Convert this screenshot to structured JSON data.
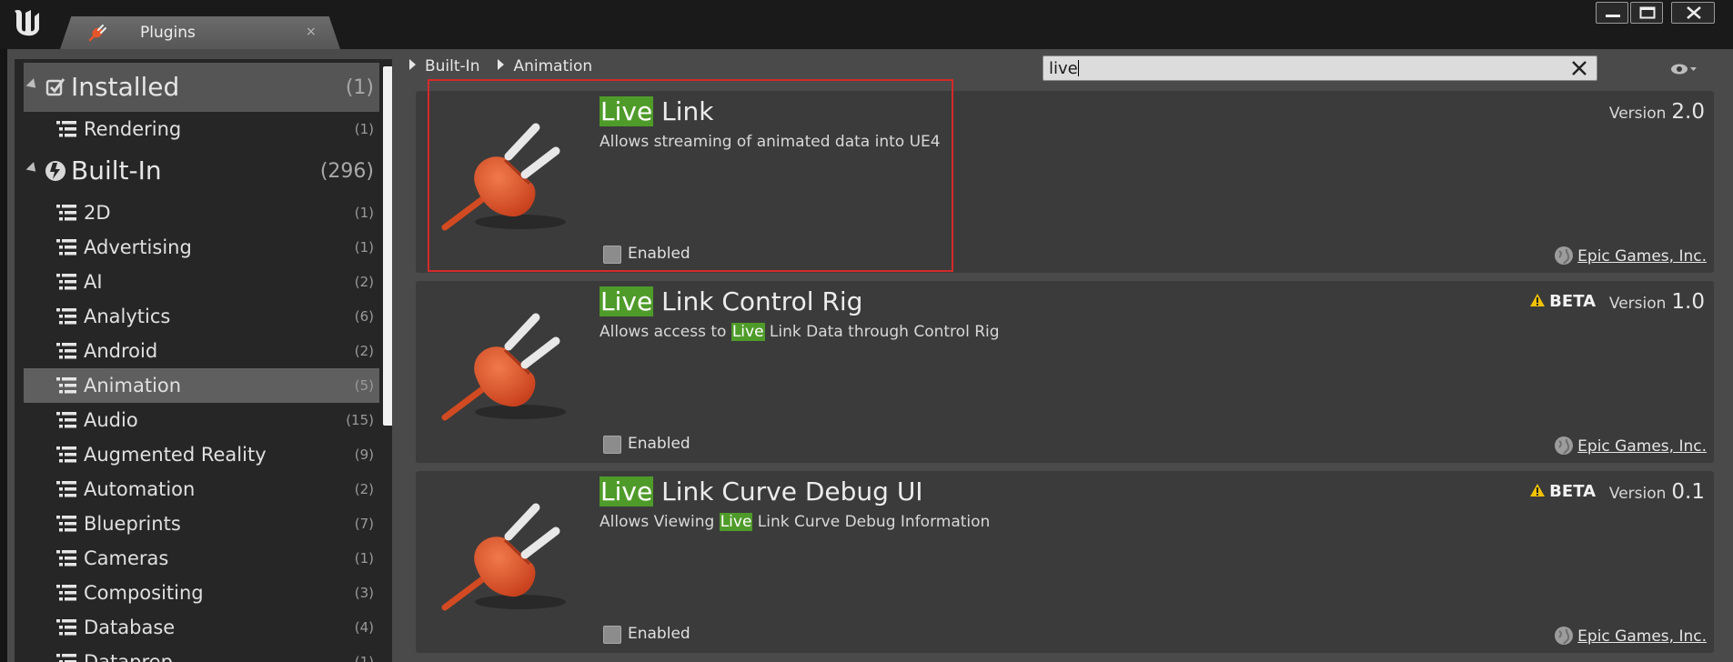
{
  "window": {
    "tab_title": "Plugins",
    "tab_close": "×"
  },
  "sidebar": {
    "categories": [
      {
        "label": "Installed",
        "count": "(1)",
        "items": [
          {
            "label": "Rendering",
            "count": "(1)"
          }
        ]
      },
      {
        "label": "Built-In",
        "count": "(296)",
        "items": [
          {
            "label": "2D",
            "count": "(1)"
          },
          {
            "label": "Advertising",
            "count": "(1)"
          },
          {
            "label": "AI",
            "count": "(2)"
          },
          {
            "label": "Analytics",
            "count": "(6)"
          },
          {
            "label": "Android",
            "count": "(2)"
          },
          {
            "label": "Animation",
            "count": "(5)",
            "selected": true
          },
          {
            "label": "Audio",
            "count": "(15)"
          },
          {
            "label": "Augmented Reality",
            "count": "(9)"
          },
          {
            "label": "Automation",
            "count": "(2)"
          },
          {
            "label": "Blueprints",
            "count": "(7)"
          },
          {
            "label": "Cameras",
            "count": "(1)"
          },
          {
            "label": "Compositing",
            "count": "(3)"
          },
          {
            "label": "Database",
            "count": "(4)"
          },
          {
            "label": "Dataprep",
            "count": "(1)"
          }
        ]
      }
    ]
  },
  "breadcrumb": [
    "Built-In",
    "Animation"
  ],
  "search": {
    "value": "live"
  },
  "plugins": [
    {
      "title_hl": "Live",
      "title_rest": " Link",
      "desc_parts": [
        {
          "text": "Allows streaming of animated data into UE4",
          "hl": false
        }
      ],
      "enabled_label": "Enabled",
      "version_label": "Version",
      "version": "2.0",
      "beta": "",
      "author": "Epic Games, Inc."
    },
    {
      "title_hl": "Live",
      "title_rest": " Link Control Rig",
      "desc_parts": [
        {
          "text": "Allows access to ",
          "hl": false
        },
        {
          "text": "Live",
          "hl": true
        },
        {
          "text": " Link Data through Control Rig",
          "hl": false
        }
      ],
      "enabled_label": "Enabled",
      "version_label": "Version",
      "version": "1.0",
      "beta": "BETA",
      "author": "Epic Games, Inc."
    },
    {
      "title_hl": "Live",
      "title_rest": " Link Curve Debug UI",
      "desc_parts": [
        {
          "text": "Allows Viewing ",
          "hl": false
        },
        {
          "text": "Live",
          "hl": true
        },
        {
          "text": " Link Curve Debug Information",
          "hl": false
        }
      ],
      "enabled_label": "Enabled",
      "version_label": "Version",
      "version": "0.1",
      "beta": "BETA",
      "author": "Epic Games, Inc."
    }
  ],
  "colors": {
    "search_highlight": "#4f9b2a",
    "annotation_box": "#d42a2a",
    "plug_orange": "#e4552b"
  }
}
